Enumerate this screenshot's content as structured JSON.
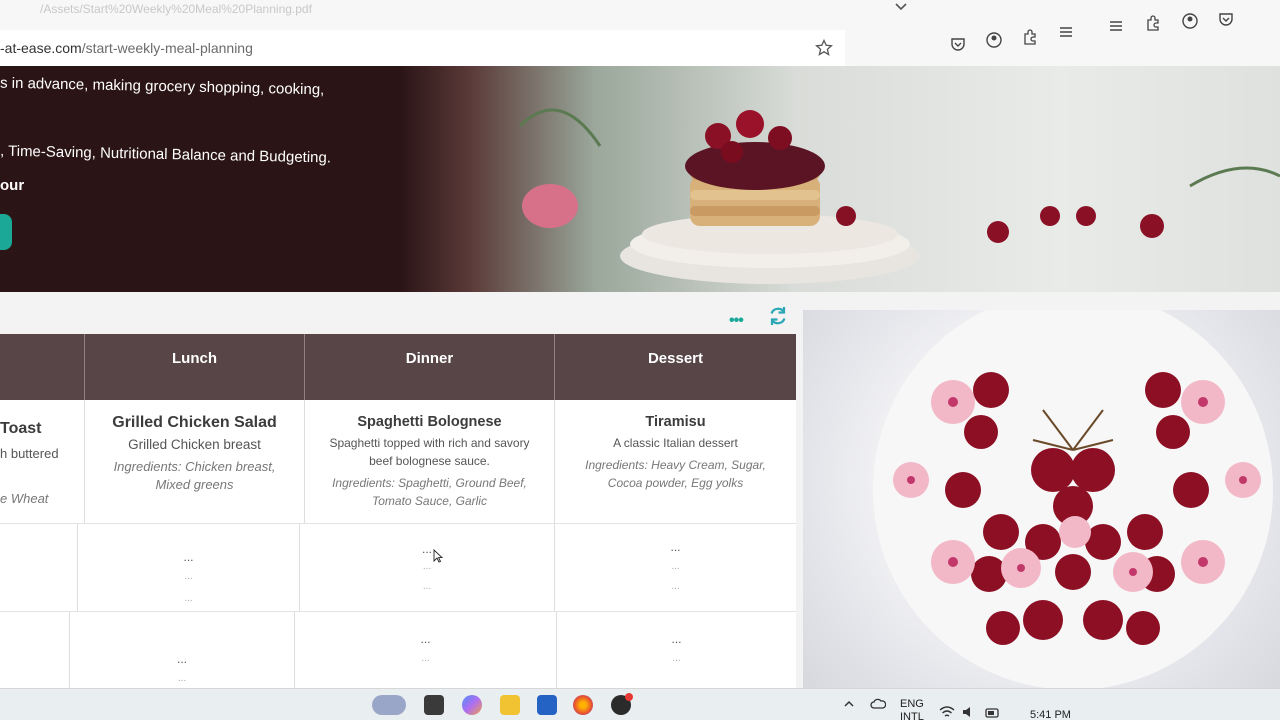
{
  "browser": {
    "url_domain": "-at-ease.com",
    "url_path": "/start-weekly-meal-planning",
    "url_ghost": "/Assets/Start%20Weekly%20Meal%20Planning.pdf"
  },
  "hero": {
    "line1": "s in advance, making grocery shopping, cooking,",
    "line2": ", Time-Saving, Nutritional Balance and Budgeting.",
    "line3": "our"
  },
  "table": {
    "headers": [
      "Lunch",
      "Dinner",
      "Dessert"
    ],
    "breakfast": {
      "dish": "Toast",
      "desc": "h buttered",
      "ingr": "e Wheat"
    },
    "lunch": {
      "dish": "Grilled Chicken Salad",
      "desc": "Grilled Chicken breast",
      "ingr1": "Ingredients: Chicken breast,",
      "ingr2": "Mixed greens"
    },
    "dinner": {
      "dish": "Spaghetti Bolognese",
      "desc1": "Spaghetti topped with rich and savory",
      "desc2": "beef bolognese sauce.",
      "ingr1": "Ingredients: Spaghetti, Ground Beef,",
      "ingr2": "Tomato Sauce, Garlic"
    },
    "dessert": {
      "dish": "Tiramisu",
      "desc": "A classic Italian dessert",
      "ingr1": "Ingredients: Heavy Cream, Sugar,",
      "ingr2": "Cocoa powder, Egg yolks"
    },
    "placeholder": "...",
    "more_menu": "•••"
  },
  "taskbar": {
    "lang1": "ENG",
    "lang2": "INTL",
    "time": "5:41 PM"
  },
  "colors": {
    "header_bg": "#574548",
    "accent": "#1ba897",
    "hero_dark": "#2b1416"
  }
}
